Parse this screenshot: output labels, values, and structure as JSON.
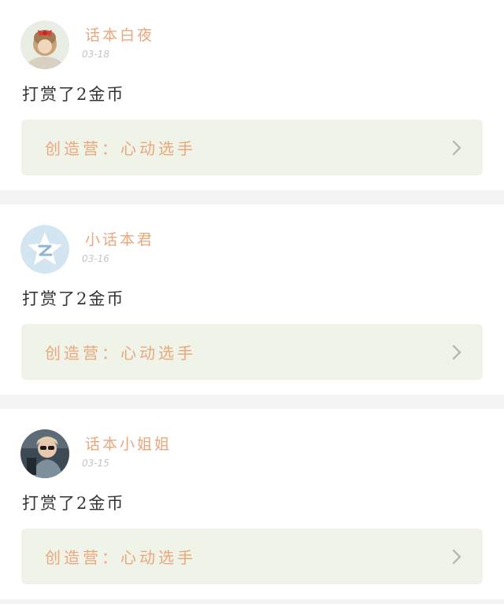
{
  "posts": [
    {
      "username": "话本白夜",
      "date": "03-18",
      "action": "打赏了2金币",
      "link_label": "创造营：心动选手",
      "avatar_icon": "girl-with-red-bow-avatar"
    },
    {
      "username": "小话本君",
      "date": "03-16",
      "action": "打赏了2金币",
      "link_label": "创造营：心动选手",
      "avatar_icon": "star-z-logo-avatar"
    },
    {
      "username": "话本小姐姐",
      "date": "03-15",
      "action": "打赏了2金币",
      "link_label": "创造营：心动选手",
      "avatar_icon": "woman-with-sunglasses-avatar"
    }
  ],
  "colors": {
    "accent": "#e9a77d",
    "link_box_bg": "#f0f3e8",
    "divider_bg": "#f3f3f3",
    "date_text": "#c9c4c0",
    "body_text": "#333333",
    "chevron": "#b8b8b8"
  }
}
